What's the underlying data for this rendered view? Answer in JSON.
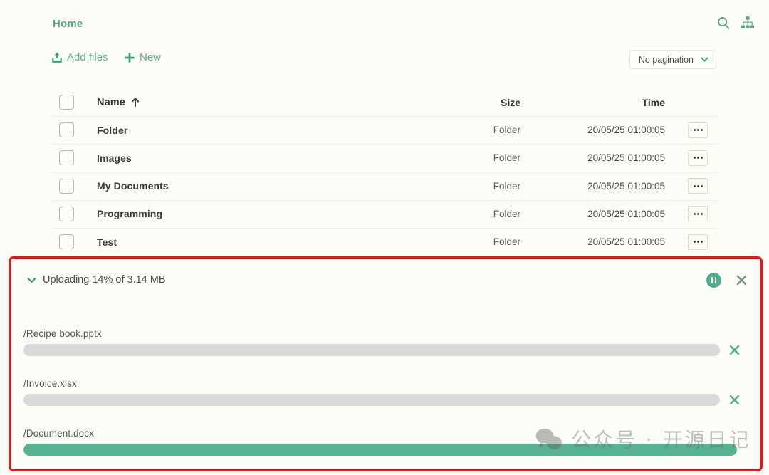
{
  "breadcrumb": {
    "label": "Home"
  },
  "top_icons": [
    {
      "name": "search-icon",
      "label": "Search"
    },
    {
      "name": "sitemap-icon",
      "label": "Tree view"
    }
  ],
  "actions": {
    "add_files": "Add files",
    "new": "New"
  },
  "pagination": {
    "selected": "No pagination",
    "options": [
      "No pagination"
    ]
  },
  "table": {
    "headers": {
      "name": "Name",
      "size": "Size",
      "time": "Time"
    },
    "sort": {
      "column": "Name",
      "direction": "ascending",
      "glyph": "↑"
    },
    "rows": [
      {
        "name": "Folder",
        "size": "Folder",
        "time": "20/05/25 01:00:05"
      },
      {
        "name": "Images",
        "size": "Folder",
        "time": "20/05/25 01:00:05"
      },
      {
        "name": "My Documents",
        "size": "Folder",
        "time": "20/05/25 01:00:05"
      },
      {
        "name": "Programming",
        "size": "Folder",
        "time": "20/05/25 01:00:05"
      },
      {
        "name": "Test",
        "size": "Folder",
        "time": "20/05/25 01:00:05"
      }
    ]
  },
  "upload_panel": {
    "status": "Uploading 14% of 3.14 MB",
    "percent": 14,
    "total_size": "3.14 MB",
    "pause_label": "Pause",
    "close_label": "Close",
    "files": [
      {
        "path": "/Recipe book.pptx",
        "progress": 0
      },
      {
        "path": "/Invoice.xlsx",
        "progress": 0
      },
      {
        "path": "/Document.docx",
        "progress": 100
      }
    ]
  },
  "watermark": {
    "text": "公众号 · 开源日记"
  },
  "colors": {
    "accent": "#4fad91",
    "background": "#fdfdf7",
    "progress_track": "#d9d9d9",
    "progress_fill": "#55b391",
    "highlight": "#fb0b09"
  }
}
